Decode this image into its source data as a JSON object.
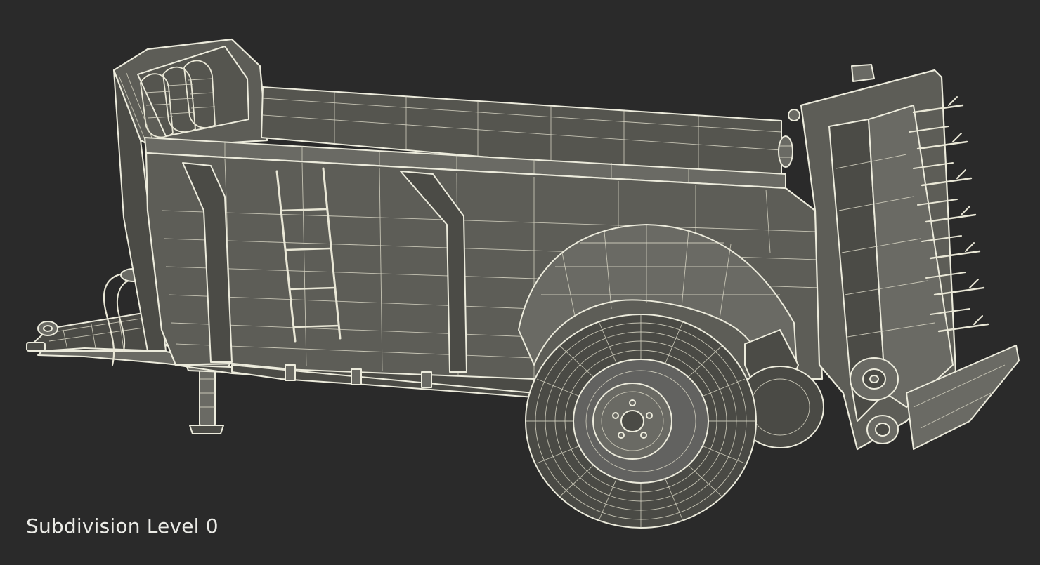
{
  "caption": {
    "text": "Subdivision Level 0"
  },
  "viewport": {
    "background_color": "#2a2a2a",
    "wire_color": "#e9e7d6",
    "surface_color": "#5d5d57"
  }
}
